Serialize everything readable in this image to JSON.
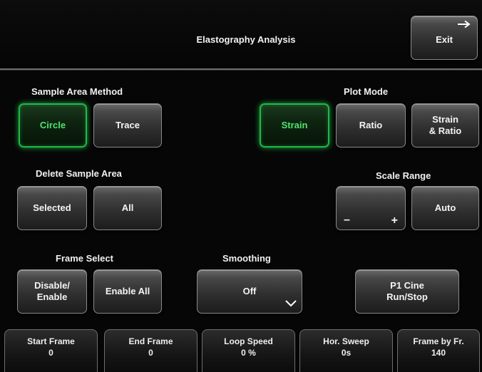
{
  "header": {
    "title": "Elastography Analysis",
    "exit_label": "Exit"
  },
  "sample_area_method": {
    "label": "Sample Area Method",
    "circle": "Circle",
    "trace": "Trace",
    "selected": "circle"
  },
  "plot_mode": {
    "label": "Plot Mode",
    "strain": "Strain",
    "ratio": "Ratio",
    "strain_ratio_line1": "Strain",
    "strain_ratio_line2": "& Ratio",
    "selected": "strain"
  },
  "delete_sample_area": {
    "label": "Delete Sample Area",
    "selected": "Selected",
    "all": "All"
  },
  "scale_range": {
    "label": "Scale Range",
    "minus": "–",
    "plus": "+",
    "auto": "Auto"
  },
  "frame_select": {
    "label": "Frame Select",
    "disable_enable_line1": "Disable/",
    "disable_enable_line2": "Enable",
    "enable_all": "Enable All"
  },
  "smoothing": {
    "label": "Smoothing",
    "value": "Off"
  },
  "cine": {
    "line1": "P1 Cine",
    "line2": "Run/Stop"
  },
  "footer": [
    {
      "label": "Start Frame",
      "value": "0"
    },
    {
      "label": "End Frame",
      "value": "0"
    },
    {
      "label": "Loop Speed",
      "value": "0 %"
    },
    {
      "label": "Hor. Sweep",
      "value": "0s"
    },
    {
      "label": "Frame by Fr.",
      "value": "140"
    }
  ],
  "colors": {
    "active_border": "#1fb84a",
    "active_text": "#4ee46c",
    "background": "#060606"
  }
}
